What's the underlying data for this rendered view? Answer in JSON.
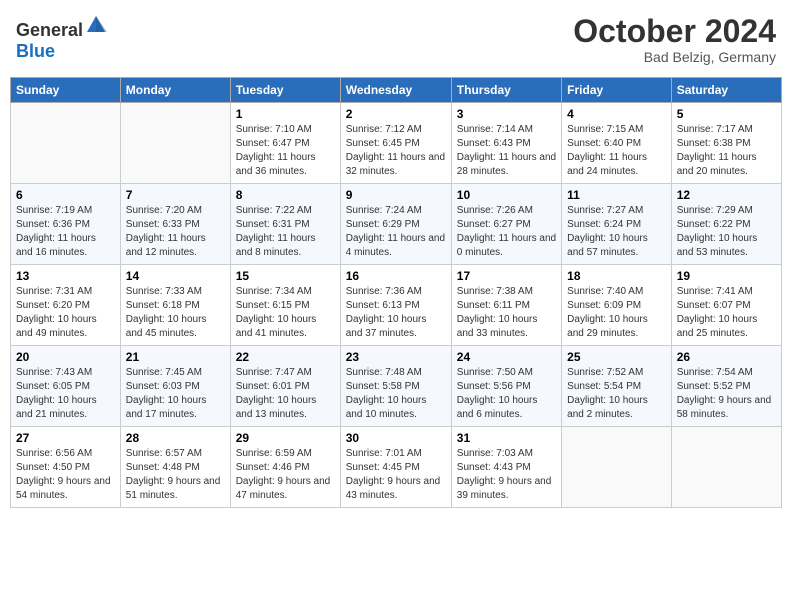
{
  "header": {
    "logo_general": "General",
    "logo_blue": "Blue",
    "month_title": "October 2024",
    "subtitle": "Bad Belzig, Germany"
  },
  "weekdays": [
    "Sunday",
    "Monday",
    "Tuesday",
    "Wednesday",
    "Thursday",
    "Friday",
    "Saturday"
  ],
  "weeks": [
    [
      {
        "day": "",
        "sunrise": "",
        "sunset": "",
        "daylight": ""
      },
      {
        "day": "",
        "sunrise": "",
        "sunset": "",
        "daylight": ""
      },
      {
        "day": "1",
        "sunrise": "Sunrise: 7:10 AM",
        "sunset": "Sunset: 6:47 PM",
        "daylight": "Daylight: 11 hours and 36 minutes."
      },
      {
        "day": "2",
        "sunrise": "Sunrise: 7:12 AM",
        "sunset": "Sunset: 6:45 PM",
        "daylight": "Daylight: 11 hours and 32 minutes."
      },
      {
        "day": "3",
        "sunrise": "Sunrise: 7:14 AM",
        "sunset": "Sunset: 6:43 PM",
        "daylight": "Daylight: 11 hours and 28 minutes."
      },
      {
        "day": "4",
        "sunrise": "Sunrise: 7:15 AM",
        "sunset": "Sunset: 6:40 PM",
        "daylight": "Daylight: 11 hours and 24 minutes."
      },
      {
        "day": "5",
        "sunrise": "Sunrise: 7:17 AM",
        "sunset": "Sunset: 6:38 PM",
        "daylight": "Daylight: 11 hours and 20 minutes."
      }
    ],
    [
      {
        "day": "6",
        "sunrise": "Sunrise: 7:19 AM",
        "sunset": "Sunset: 6:36 PM",
        "daylight": "Daylight: 11 hours and 16 minutes."
      },
      {
        "day": "7",
        "sunrise": "Sunrise: 7:20 AM",
        "sunset": "Sunset: 6:33 PM",
        "daylight": "Daylight: 11 hours and 12 minutes."
      },
      {
        "day": "8",
        "sunrise": "Sunrise: 7:22 AM",
        "sunset": "Sunset: 6:31 PM",
        "daylight": "Daylight: 11 hours and 8 minutes."
      },
      {
        "day": "9",
        "sunrise": "Sunrise: 7:24 AM",
        "sunset": "Sunset: 6:29 PM",
        "daylight": "Daylight: 11 hours and 4 minutes."
      },
      {
        "day": "10",
        "sunrise": "Sunrise: 7:26 AM",
        "sunset": "Sunset: 6:27 PM",
        "daylight": "Daylight: 11 hours and 0 minutes."
      },
      {
        "day": "11",
        "sunrise": "Sunrise: 7:27 AM",
        "sunset": "Sunset: 6:24 PM",
        "daylight": "Daylight: 10 hours and 57 minutes."
      },
      {
        "day": "12",
        "sunrise": "Sunrise: 7:29 AM",
        "sunset": "Sunset: 6:22 PM",
        "daylight": "Daylight: 10 hours and 53 minutes."
      }
    ],
    [
      {
        "day": "13",
        "sunrise": "Sunrise: 7:31 AM",
        "sunset": "Sunset: 6:20 PM",
        "daylight": "Daylight: 10 hours and 49 minutes."
      },
      {
        "day": "14",
        "sunrise": "Sunrise: 7:33 AM",
        "sunset": "Sunset: 6:18 PM",
        "daylight": "Daylight: 10 hours and 45 minutes."
      },
      {
        "day": "15",
        "sunrise": "Sunrise: 7:34 AM",
        "sunset": "Sunset: 6:15 PM",
        "daylight": "Daylight: 10 hours and 41 minutes."
      },
      {
        "day": "16",
        "sunrise": "Sunrise: 7:36 AM",
        "sunset": "Sunset: 6:13 PM",
        "daylight": "Daylight: 10 hours and 37 minutes."
      },
      {
        "day": "17",
        "sunrise": "Sunrise: 7:38 AM",
        "sunset": "Sunset: 6:11 PM",
        "daylight": "Daylight: 10 hours and 33 minutes."
      },
      {
        "day": "18",
        "sunrise": "Sunrise: 7:40 AM",
        "sunset": "Sunset: 6:09 PM",
        "daylight": "Daylight: 10 hours and 29 minutes."
      },
      {
        "day": "19",
        "sunrise": "Sunrise: 7:41 AM",
        "sunset": "Sunset: 6:07 PM",
        "daylight": "Daylight: 10 hours and 25 minutes."
      }
    ],
    [
      {
        "day": "20",
        "sunrise": "Sunrise: 7:43 AM",
        "sunset": "Sunset: 6:05 PM",
        "daylight": "Daylight: 10 hours and 21 minutes."
      },
      {
        "day": "21",
        "sunrise": "Sunrise: 7:45 AM",
        "sunset": "Sunset: 6:03 PM",
        "daylight": "Daylight: 10 hours and 17 minutes."
      },
      {
        "day": "22",
        "sunrise": "Sunrise: 7:47 AM",
        "sunset": "Sunset: 6:01 PM",
        "daylight": "Daylight: 10 hours and 13 minutes."
      },
      {
        "day": "23",
        "sunrise": "Sunrise: 7:48 AM",
        "sunset": "Sunset: 5:58 PM",
        "daylight": "Daylight: 10 hours and 10 minutes."
      },
      {
        "day": "24",
        "sunrise": "Sunrise: 7:50 AM",
        "sunset": "Sunset: 5:56 PM",
        "daylight": "Daylight: 10 hours and 6 minutes."
      },
      {
        "day": "25",
        "sunrise": "Sunrise: 7:52 AM",
        "sunset": "Sunset: 5:54 PM",
        "daylight": "Daylight: 10 hours and 2 minutes."
      },
      {
        "day": "26",
        "sunrise": "Sunrise: 7:54 AM",
        "sunset": "Sunset: 5:52 PM",
        "daylight": "Daylight: 9 hours and 58 minutes."
      }
    ],
    [
      {
        "day": "27",
        "sunrise": "Sunrise: 6:56 AM",
        "sunset": "Sunset: 4:50 PM",
        "daylight": "Daylight: 9 hours and 54 minutes."
      },
      {
        "day": "28",
        "sunrise": "Sunrise: 6:57 AM",
        "sunset": "Sunset: 4:48 PM",
        "daylight": "Daylight: 9 hours and 51 minutes."
      },
      {
        "day": "29",
        "sunrise": "Sunrise: 6:59 AM",
        "sunset": "Sunset: 4:46 PM",
        "daylight": "Daylight: 9 hours and 47 minutes."
      },
      {
        "day": "30",
        "sunrise": "Sunrise: 7:01 AM",
        "sunset": "Sunset: 4:45 PM",
        "daylight": "Daylight: 9 hours and 43 minutes."
      },
      {
        "day": "31",
        "sunrise": "Sunrise: 7:03 AM",
        "sunset": "Sunset: 4:43 PM",
        "daylight": "Daylight: 9 hours and 39 minutes."
      },
      {
        "day": "",
        "sunrise": "",
        "sunset": "",
        "daylight": ""
      },
      {
        "day": "",
        "sunrise": "",
        "sunset": "",
        "daylight": ""
      }
    ]
  ]
}
